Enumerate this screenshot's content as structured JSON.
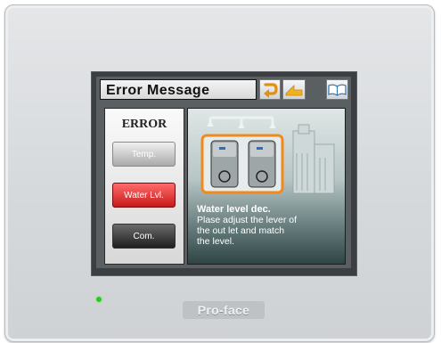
{
  "screen": {
    "title": "Error Message",
    "toolbar_icons": [
      "undo-arrow-icon",
      "back-arrow-icon",
      "manual-book-icon"
    ],
    "error_heading": "ERROR",
    "buttons": [
      {
        "label": "Temp.",
        "state": "inactive"
      },
      {
        "label": "Water Lvl.",
        "state": "active"
      },
      {
        "label": "Com.",
        "state": "inactive"
      }
    ],
    "message": {
      "title": "Water level dec.",
      "body_lines": [
        "Plase adjust the lever of",
        "the out let and match",
        "the level."
      ]
    }
  },
  "device": {
    "brand": "Pro-face",
    "status_led_color": "#2ec52e"
  },
  "colors": {
    "active_button": "#d92a2a",
    "highlight_border": "#f08a1c"
  }
}
